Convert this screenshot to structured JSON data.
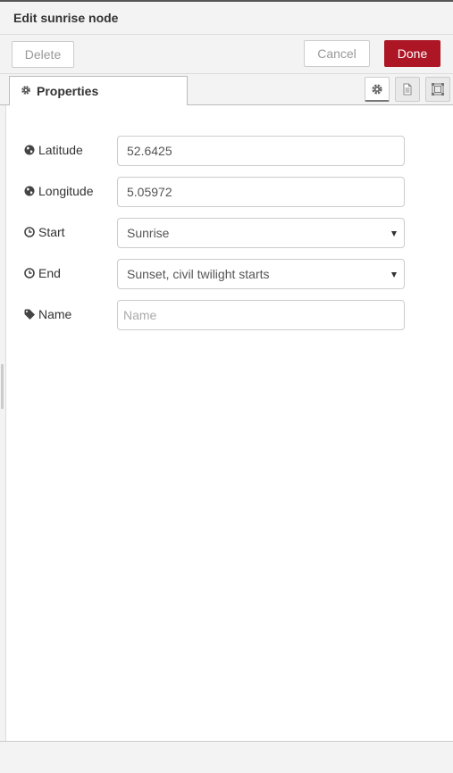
{
  "tray": {
    "title": "Edit sunrise node"
  },
  "toolbar": {
    "delete_label": "Delete",
    "cancel_label": "Cancel",
    "done_label": "Done",
    "done_color": "#ad1625"
  },
  "tabs": {
    "properties_label": "Properties",
    "icon": "gear-icon"
  },
  "side_buttons": [
    {
      "name": "properties",
      "icon": "gear-icon"
    },
    {
      "name": "description",
      "icon": "document-icon"
    },
    {
      "name": "appearance",
      "icon": "frame-icon"
    }
  ],
  "form": {
    "latitude": {
      "label": "Latitude",
      "value": "52.6425",
      "icon": "globe-icon"
    },
    "longitude": {
      "label": "Longitude",
      "value": "5.05972",
      "icon": "globe-icon"
    },
    "start": {
      "label": "Start",
      "value": "Sunrise",
      "icon": "clock-icon"
    },
    "end": {
      "label": "End",
      "value": "Sunset, civil twilight starts",
      "icon": "clock-icon"
    },
    "name": {
      "label": "Name",
      "value": "",
      "placeholder": "Name",
      "icon": "tag-icon"
    }
  }
}
